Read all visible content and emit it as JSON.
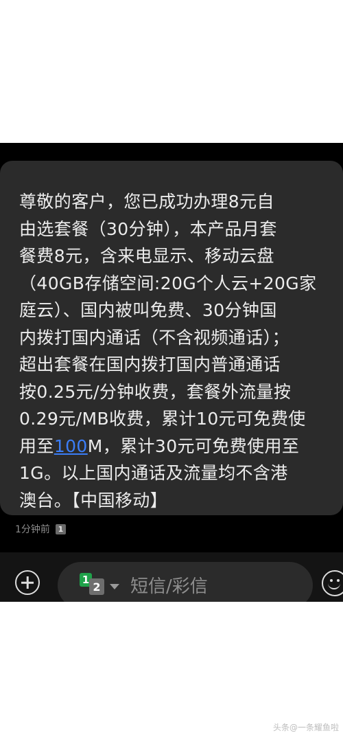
{
  "message": {
    "lines": [
      "尊敬的客户，您已成功办理8元自",
      "由选套餐（30分钟），本产品月套",
      "餐费8元，含来电显示、移动云盘",
      "（40GB存储空间:20G个人云+20G家",
      "庭云）、国内被叫免费、30分钟国",
      "内拨打国内通话（不含视频通话）；",
      "超出套餐在国内拨打国内普通通话",
      "按0.25元/分钟收费，套餐外流量按",
      "0.29元/MB收费，累计10元可免费使",
      "用至",
      "M，累计30元可免费使用至",
      "1G。以上国内通话及流量均不含港",
      "澳台。【中国移动】"
    ],
    "link_text": "100",
    "timestamp": "1分钟前",
    "sim_badge": "1"
  },
  "composer": {
    "sim1": "1",
    "sim2": "2",
    "placeholder": "短信/彩信"
  },
  "watermark": "头条@一条耀鱼啦",
  "colors": {
    "background": "#000000",
    "bubble": "#2b2b2b",
    "text": "#ececec",
    "link": "#3b7ef8",
    "sim1": "#1fa24a"
  }
}
